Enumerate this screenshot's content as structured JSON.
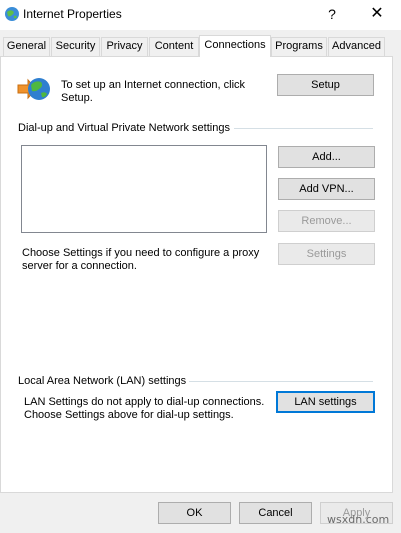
{
  "window": {
    "title": "Internet Properties",
    "help_label": "?",
    "close_label": "✕"
  },
  "tabs": [
    {
      "label": "General"
    },
    {
      "label": "Security"
    },
    {
      "label": "Privacy"
    },
    {
      "label": "Content"
    },
    {
      "label": "Connections"
    },
    {
      "label": "Programs"
    },
    {
      "label": "Advanced"
    }
  ],
  "active_tab": "Connections",
  "connection": {
    "setup_text_line1": "To set up an Internet connection, click",
    "setup_text_line2": "Setup.",
    "setup_button": "Setup"
  },
  "dialup": {
    "section_label": "Dial-up and Virtual Private Network settings",
    "add_button": "Add...",
    "add_vpn_button": "Add VPN...",
    "remove_button": "Remove...",
    "proxy_text_line1": "Choose Settings if you need to configure a proxy",
    "proxy_text_line2": "server for a connection.",
    "settings_button": "Settings"
  },
  "lan": {
    "section_label": "Local Area Network (LAN) settings",
    "text_line1": "LAN Settings do not apply to dial-up connections.",
    "text_line2": "Choose Settings above for dial-up settings.",
    "lan_settings_button": "LAN settings"
  },
  "footer": {
    "ok_button": "OK",
    "cancel_button": "Cancel",
    "apply_button": "Apply"
  },
  "watermark": "wsxdn.com",
  "colors": {
    "focus_border": "#0078d7",
    "disabled_text": "#9a9a9a",
    "panel_bg": "#ffffff",
    "window_bg": "#f0f0f0"
  }
}
